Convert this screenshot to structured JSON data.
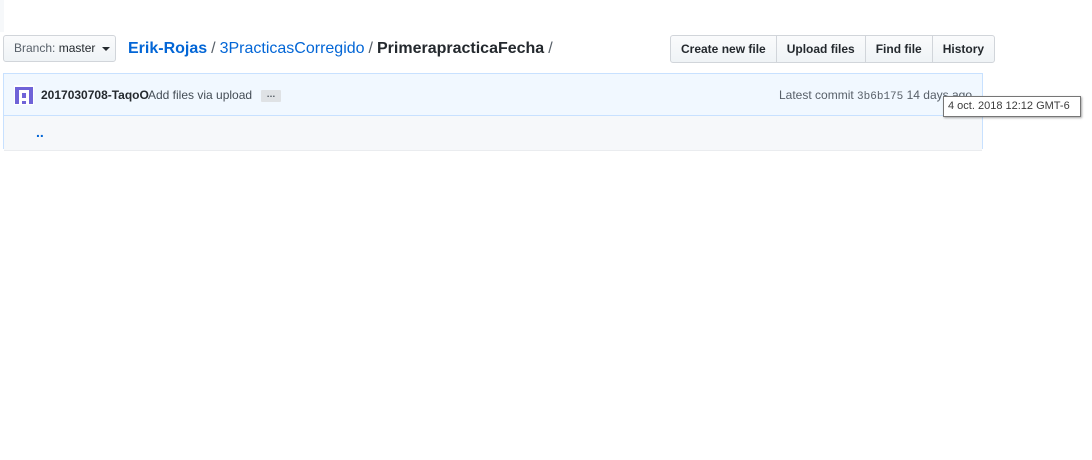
{
  "branch": {
    "prefix": "Branch:",
    "name": "master"
  },
  "breadcrumb": {
    "owner": "Erik-Rojas",
    "repo": "3PracticasCorregido",
    "folder": "PrimerapracticaFecha",
    "separator": "/"
  },
  "actions": {
    "create_new_file": "Create new file",
    "upload_files": "Upload files",
    "find_file": "Find file",
    "history": "History"
  },
  "commit": {
    "author": "2017030708-TaqoO",
    "message": "Add files via upload",
    "ellipsis": "…",
    "latest_label": "Latest commit",
    "sha": "3b6b175",
    "age": "14 days ago"
  },
  "files": {
    "parent_link": ".."
  },
  "tooltip": {
    "text": "4 oct. 2018 12:12 GMT-6"
  },
  "colors": {
    "link": "#0366d6",
    "commit_bar_bg": "#f1f8ff",
    "avatar": "#6f63d8"
  }
}
